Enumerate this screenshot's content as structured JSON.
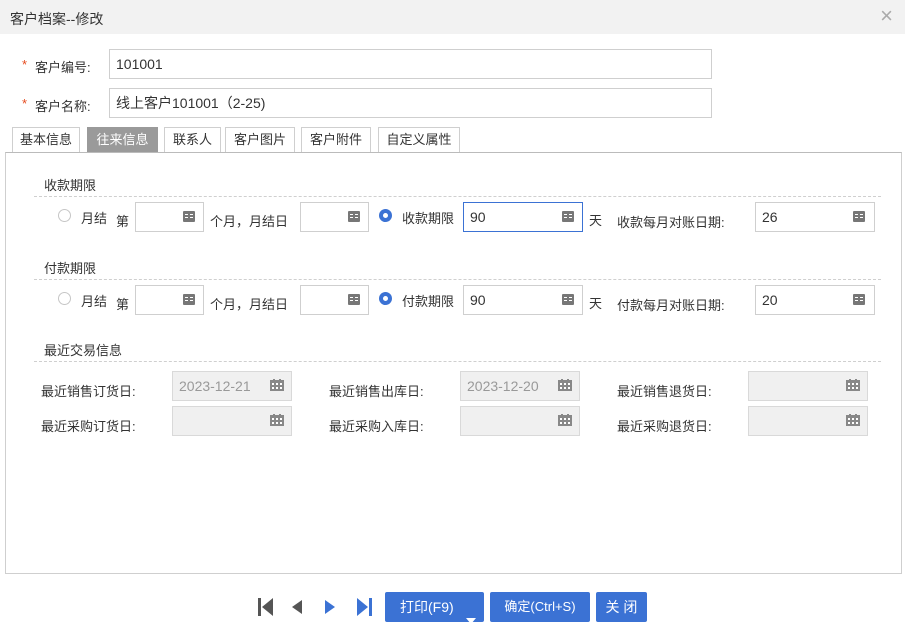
{
  "window": {
    "title": "客户档案--修改"
  },
  "customer": {
    "code_label": "客户编号:",
    "code_value": "101001",
    "name_label": "客户名称:",
    "name_value": "线上客户101001（2-25)"
  },
  "tabs": [
    {
      "label": "基本信息"
    },
    {
      "label": "往来信息"
    },
    {
      "label": "联系人"
    },
    {
      "label": "客户图片"
    },
    {
      "label": "客户附件"
    },
    {
      "label": "自定义属性"
    }
  ],
  "receivable": {
    "section_title": "收款期限",
    "monthly_label": "月结",
    "nth_label": "第",
    "months_value": "",
    "month_suffix_label": "个月，月结日",
    "day_value": "",
    "term_label": "收款期限",
    "term_value": "90",
    "unit_label": "天",
    "recon_label": "收款每月对账日期:",
    "recon_value": "26"
  },
  "payable": {
    "section_title": "付款期限",
    "monthly_label": "月结",
    "nth_label": "第",
    "months_value": "",
    "month_suffix_label": "个月，月结日",
    "day_value": "",
    "term_label": "付款期限",
    "term_value": "90",
    "unit_label": "天",
    "recon_label": "付款每月对账日期:",
    "recon_value": "20"
  },
  "recent": {
    "section_title": "最近交易信息",
    "sale_order_label": "最近销售订货日:",
    "sale_order_value": "2023-12-21",
    "sale_out_label": "最近销售出库日:",
    "sale_out_value": "2023-12-20",
    "sale_return_label": "最近销售退货日:",
    "sale_return_value": "",
    "purchase_order_label": "最近采购订货日:",
    "purchase_order_value": "",
    "purchase_in_label": "最近采购入库日:",
    "purchase_in_value": "",
    "purchase_return_label": "最近采购退货日:",
    "purchase_return_value": ""
  },
  "footer": {
    "print_label": "打印(F9)",
    "save_label": "确定(Ctrl+S)",
    "close_label": "关 闭"
  },
  "colors": {
    "accent": "#3b72d4",
    "required": "#e64b1e",
    "active_tab": "#9a9a9a"
  }
}
